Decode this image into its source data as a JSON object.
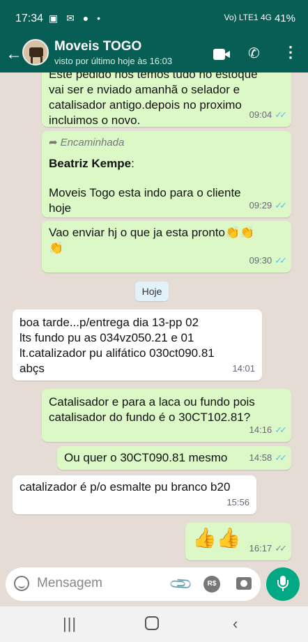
{
  "status_bar": {
    "time": "17:34",
    "battery": "41%",
    "signal_text": "Vo) LTE1 4G"
  },
  "header": {
    "contact_name": "Moveis TOGO",
    "last_seen": "visto por último hoje às 16:03"
  },
  "messages": [
    {
      "direction": "out",
      "text": "Este pedido nos temos tudo no estoque\nvai ser e nviado amanhã o selador e\ncatalisador antigo.depois no proximo\nincluimos o novo.",
      "time": "09:04",
      "read": true
    },
    {
      "direction": "out",
      "forwarded_label": "Encaminhada",
      "sender": "Beatriz Kempe",
      "text": "Moveis Togo esta indo para o cliente\nhoje",
      "time": "09:29",
      "read": true
    },
    {
      "direction": "out",
      "text": "Vao enviar hj o que ja esta pronto👏👏\n👏",
      "time": "09:30",
      "read": true
    },
    {
      "direction": "in",
      "text": "boa tarde...p/entrega dia 13-pp 02\nlts fundo pu as 034vz050.21 e 01\nlt.catalizador pu alifático  030ct090.81\nabçs",
      "time": "14:01"
    },
    {
      "direction": "out",
      "text": "Catalisador e para a laca ou fundo pois\ncatalisador do fundo é o 30CT102.81?",
      "time": "14:16",
      "read": true
    },
    {
      "direction": "out",
      "text": "Ou quer o 30CT090.81 mesmo",
      "time": "14:58",
      "read": true
    },
    {
      "direction": "in",
      "text": "catalizador é p/o esmalte pu branco b20",
      "time": "15:56"
    },
    {
      "direction": "out",
      "text": "👍👍",
      "time": "16:17",
      "read": false
    }
  ],
  "date_chip": "Hoje",
  "composer": {
    "placeholder": "Mensagem",
    "currency_label": "R$"
  },
  "colors": {
    "header": "#075e54",
    "outgoing": "#dcf8c6",
    "incoming": "#ffffff",
    "mic": "#00a884",
    "read_ticks": "#4fc3f7"
  }
}
